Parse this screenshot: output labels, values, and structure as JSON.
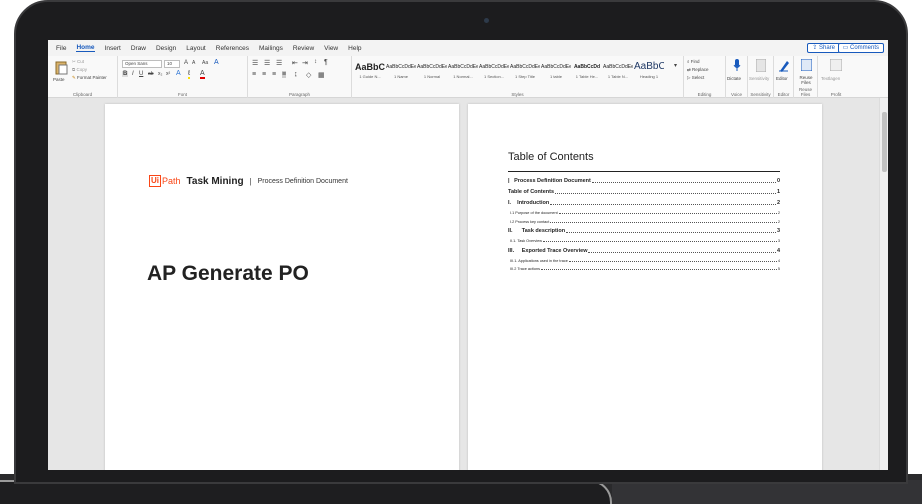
{
  "ribbon": {
    "tabs": [
      {
        "label": "File",
        "active": false
      },
      {
        "label": "Home",
        "active": true
      },
      {
        "label": "Insert",
        "active": false
      },
      {
        "label": "Draw",
        "active": false
      },
      {
        "label": "Design",
        "active": false
      },
      {
        "label": "Layout",
        "active": false
      },
      {
        "label": "References",
        "active": false
      },
      {
        "label": "Mailings",
        "active": false
      },
      {
        "label": "Review",
        "active": false
      },
      {
        "label": "View",
        "active": false
      },
      {
        "label": "Help",
        "active": false
      }
    ],
    "share_label": "Share",
    "comments_label": "Comments",
    "clipboard": {
      "paste": "Paste",
      "cut": "Cut",
      "copy": "Copy",
      "format_painter": "Format Painter",
      "group": "Clipboard"
    },
    "font": {
      "name": "Open Sans",
      "size": "10",
      "group": "Font"
    },
    "paragraph": {
      "group": "Paragraph"
    },
    "styles": {
      "group": "Styles",
      "items": [
        {
          "sample": "AaBbCcD",
          "name": "1 Guide N..."
        },
        {
          "sample": "AaBbCcDdEe",
          "name": "1 Name"
        },
        {
          "sample": "AaBbCcDdEe",
          "name": "1 Normal"
        },
        {
          "sample": "AaBbCcDdEe",
          "name": "1 Normal..."
        },
        {
          "sample": "AaBbCcDdEe",
          "name": "1 Section..."
        },
        {
          "sample": "AaBbCcDdEe",
          "name": "1 Step Title"
        },
        {
          "sample": "AaBbCcDdEe",
          "name": "1 table"
        },
        {
          "sample": "AaBbCcDd",
          "name": "1 Table He..."
        },
        {
          "sample": "AaBbCcDdEe",
          "name": "1 Table N..."
        },
        {
          "sample": "AaBbC",
          "name": "Heading 1"
        }
      ]
    },
    "editing": {
      "find": "Find",
      "replace": "Replace",
      "select": "Select",
      "group": "Editing"
    },
    "voice": {
      "dictate": "Dictate",
      "group": "Voice"
    },
    "sensitivity": {
      "label": "Sensitivity",
      "group": "Sensitivity"
    },
    "editor": {
      "label": "Editor",
      "group": "Editor"
    },
    "reuse": {
      "label": "Reuse Files",
      "group": "Reuse Files"
    },
    "profit": {
      "label": "Textlagen",
      "group": "Profit"
    }
  },
  "page1": {
    "logo_ui": "Ui",
    "logo_path": "Path",
    "product": "Task Mining",
    "separator": "|",
    "doc_type": "Process Definition Document",
    "title": "AP Generate PO"
  },
  "page2": {
    "toc_title": "Table of Contents",
    "entries": [
      {
        "text": "|   Process Definition Document",
        "page": "0",
        "level": 1
      },
      {
        "text": "Table of Contents",
        "page": "1",
        "level": 1
      },
      {
        "text": "I.    Introduction",
        "page": "2",
        "level": 1
      },
      {
        "text": "I.1 Purpose of the document",
        "page": "2",
        "level": 2
      },
      {
        "text": "I.2 Process key contact",
        "page": "2",
        "level": 2
      },
      {
        "text": "II.      Task description",
        "page": "3",
        "level": 1
      },
      {
        "text": "II.1. Task Overview",
        "page": "3",
        "level": 2
      },
      {
        "text": "III.     Exported Trace Overview",
        "page": "4",
        "level": 1
      },
      {
        "text": "III.1. Applications used in the trace",
        "page": "4",
        "level": 2
      },
      {
        "text": "III.2 Trace actions",
        "page": "5",
        "level": 2
      }
    ]
  },
  "colors": {
    "brand_orange": "#fa4616",
    "word_blue": "#185abd"
  }
}
